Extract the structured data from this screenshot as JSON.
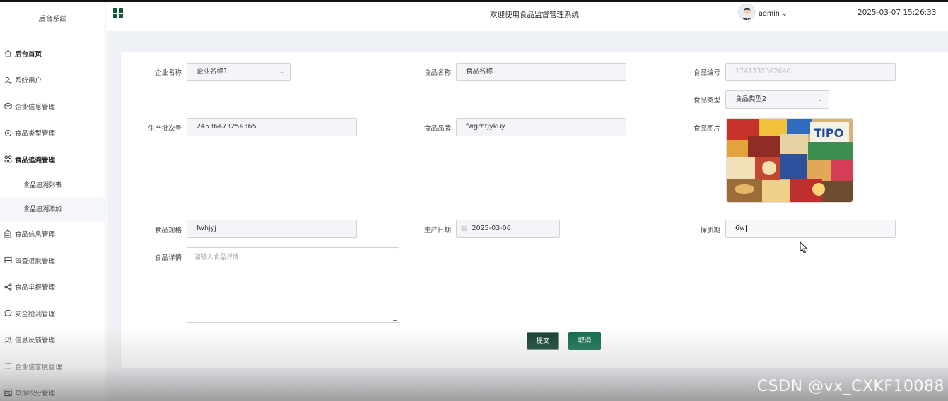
{
  "sidebar": {
    "brand": "后台系统",
    "items": [
      {
        "label": "后台首页",
        "icon": "home-icon"
      },
      {
        "label": "系统用户",
        "icon": "user-icon"
      },
      {
        "label": "企业信息管理",
        "icon": "cube-icon"
      },
      {
        "label": "食品类型管理",
        "icon": "target-icon"
      },
      {
        "label": "食品追溯管理",
        "icon": "apps-icon"
      }
    ],
    "subitems": [
      {
        "label": "食品追溯列表"
      },
      {
        "label": "食品追溯添加"
      }
    ],
    "items_after": [
      {
        "label": "食品信息管理",
        "icon": "building-icon"
      },
      {
        "label": "审查进度管理",
        "icon": "columns-icon"
      },
      {
        "label": "食品举报管理",
        "icon": "share-icon"
      },
      {
        "label": "安全检测管理",
        "icon": "chat-icon"
      },
      {
        "label": "信息反馈管理",
        "icon": "users-icon"
      },
      {
        "label": "企业信誉度管理",
        "icon": "list-icon"
      },
      {
        "label": "举报积分管理",
        "icon": "score-icon"
      }
    ]
  },
  "header": {
    "title": "欢迎使用食品监督管理系统",
    "user": "admin",
    "datetime": "2025-03-07 15:26:33"
  },
  "form": {
    "enterprise_name": {
      "label": "企业名称",
      "value": "企业名称1"
    },
    "food_name": {
      "label": "食品名称",
      "value": "食品名称"
    },
    "food_code": {
      "label": "食品编号",
      "value": "1741332362640"
    },
    "food_type": {
      "label": "食品类型",
      "value": "食品类型2"
    },
    "batch_no": {
      "label": "生产批次号",
      "value": "24536473254365"
    },
    "brand": {
      "label": "食品品牌",
      "value": "fwgrhtjykuy"
    },
    "image": {
      "label": "食品图片",
      "overlay_text": "TIPO"
    },
    "spec": {
      "label": "食品规格",
      "value": "fwhjyj"
    },
    "prod_date": {
      "label": "生产日期",
      "value": "2025-03-06"
    },
    "shelf_life": {
      "label": "保质期",
      "value": "6w"
    },
    "detail": {
      "label": "食品详情",
      "placeholder": "请输入食品详情"
    },
    "submit_label": "提交",
    "cancel_label": "取消"
  },
  "watermark": "CSDN @vx_CXKF10088",
  "colors": {
    "primary": "#0d6b48",
    "primary_dark": "#0e3f2c",
    "content_bg": "#eef1f5"
  }
}
